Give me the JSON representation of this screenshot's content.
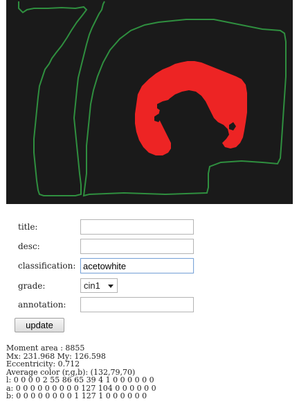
{
  "colors": {
    "canvas_background": "#1a1a1a",
    "outline": "#2f8f3f",
    "lesion": "#ed2424"
  },
  "form": {
    "title": {
      "label": "title:",
      "value": ""
    },
    "desc": {
      "label": "desc:",
      "value": ""
    },
    "classification": {
      "label": "classification:",
      "value": "acetowhite"
    },
    "grade": {
      "label": "grade:",
      "value": "cin1"
    },
    "annotation": {
      "label": "annotation:",
      "value": ""
    },
    "update_label": "update"
  },
  "stats": {
    "moment_area": "Moment area : 8855",
    "mx_my": "Mx: 231.968 My: 126.598",
    "eccentricity": "Eccentricity: 0.712",
    "average_color": "Average color (r,g,b): (132,79,70)",
    "l_hist": "l: 0 0 0 0 2 55 86 65 39 4 1 0 0 0 0 0 0",
    "a_hist": "a: 0 0 0 0 0 0 0 0 0 127 104 0 0 0 0 0 0",
    "b_hist": "b: 0 0 0 0 0 0 0 0 1 127 1 0 0 0 0 0 0"
  }
}
